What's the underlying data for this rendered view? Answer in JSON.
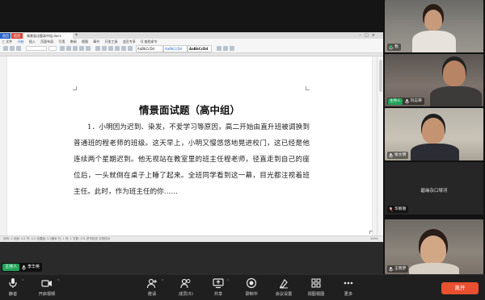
{
  "wps": {
    "tabs": [
      "首页",
      "稻壳",
      "情景面试题高中组.docx"
    ],
    "tab_plus": "+",
    "menus": [
      "三 文件",
      "开始",
      "插入",
      "页面布局",
      "引用",
      "审阅",
      "视图",
      "章节",
      "开发工具",
      "会员专享",
      "Q 查找命令"
    ],
    "style_sample": "AaBbCcDd",
    "status_bar": "页码: 1  页面: 1/1  节: 1/1  设置值: 2.5厘米  行: 1  列: 1  字数: 131  拼写检查  文档校对",
    "status_zoom": "100%"
  },
  "document": {
    "title": "情景面试题（高中组）",
    "body": "1．小明因为迟到、染发，不爱学习等原因，高二开始由直升班被调换到普通班的程老师的班级。这天早上，小明又慢悠悠地晃进校门，这已经是他连续两个星期迟到。他无视站在教室里的班主任程老师，径直走到自己的座位后，一头就倒在桌子上睡了起来。全班同学看到这一幕，目光都注视着班主任。此时，作为班主任的你……"
  },
  "presenter": {
    "host_badge": "主持人",
    "name": "李华英"
  },
  "gallery": {
    "tiles": [
      {
        "name": "我",
        "host": false
      },
      {
        "name": "刘志荣",
        "host": true,
        "host_badge": "主持人"
      },
      {
        "name": "张文明",
        "host": false
      },
      {
        "name": "华丽丽",
        "host": false,
        "center_name": "碧缘杂口琴河"
      },
      {
        "name": "王晓梦",
        "host": false
      }
    ]
  },
  "toolbar": {
    "items": [
      {
        "label": "静音",
        "icon": "microphone-icon"
      },
      {
        "label": "开启视频",
        "icon": "video-camera-icon"
      },
      {
        "label": "邀请",
        "icon": "invite-icon"
      },
      {
        "label": "成员(5)",
        "icon": "members-icon"
      },
      {
        "label": "共享",
        "icon": "share-screen-icon"
      },
      {
        "label": "录制中",
        "icon": "record-icon"
      },
      {
        "label": "会议设置",
        "icon": "settings-icon"
      },
      {
        "label": "视图视图",
        "icon": "grid-view-icon"
      },
      {
        "label": "更多",
        "icon": "more-icon"
      }
    ],
    "leave_label": "离开"
  },
  "colors": {
    "host_green": "#22a35a",
    "leave_red": "#e8502f",
    "wps_blue": "#2b64c9"
  }
}
